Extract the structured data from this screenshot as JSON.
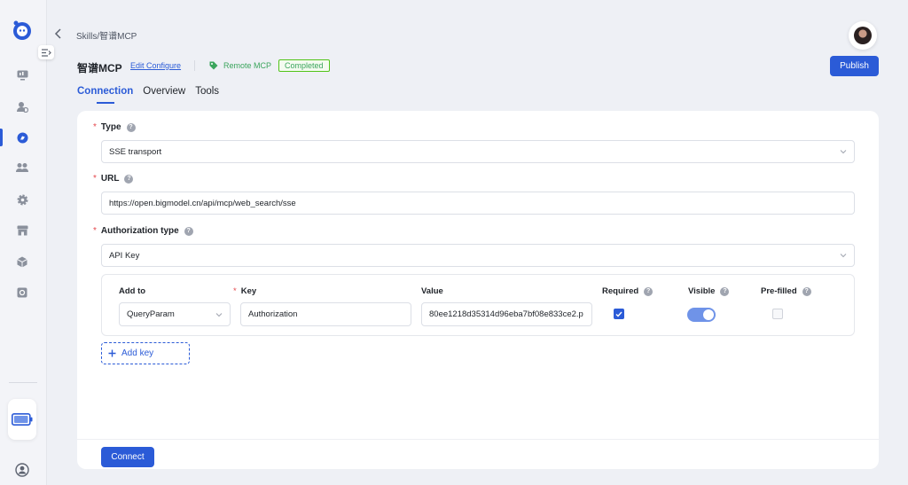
{
  "breadcrumb": "Skills/智谱MCP",
  "header": {
    "title": "智谱MCP",
    "edit_label": "Edit Configure",
    "type_tag": "Remote MCP",
    "status": "Completed",
    "publish_label": "Publish"
  },
  "tabs": [
    {
      "label": "Connection",
      "active": true
    },
    {
      "label": "Overview",
      "active": false
    },
    {
      "label": "Tools",
      "active": false
    }
  ],
  "form": {
    "type_label": "Type",
    "type_value": "SSE transport",
    "url_label": "URL",
    "url_value": "https://open.bigmodel.cn/api/mcp/web_search/sse",
    "auth_label": "Authorization type",
    "auth_value": "API Key",
    "kv": {
      "headers": {
        "add_to": "Add to",
        "key": "Key",
        "value": "Value",
        "required": "Required",
        "visible": "Visible",
        "prefilled": "Pre-filled"
      },
      "row": {
        "add_to": "QueryParam",
        "key": "Authorization",
        "value": "80ee1218d35314d96eba7bf08e833ce2.p",
        "required": true,
        "visible": true,
        "prefilled": false
      }
    },
    "add_key_label": "Add key",
    "connect_label": "Connect"
  },
  "colors": {
    "accent": "#2b5bd7",
    "success": "#3ba55d",
    "required": "#e5484d"
  },
  "icons": [
    "logo-icon",
    "collapse-sidebar-icon",
    "monitor-icon",
    "user-settings-icon",
    "skills-icon",
    "team-icon",
    "gear-icon",
    "store-icon",
    "box-icon",
    "settings-square-icon",
    "battery-icon",
    "user-circle-icon",
    "back-arrow-icon",
    "tag-icon",
    "help-icon",
    "chevron-down-icon",
    "plus-icon",
    "check-icon"
  ]
}
